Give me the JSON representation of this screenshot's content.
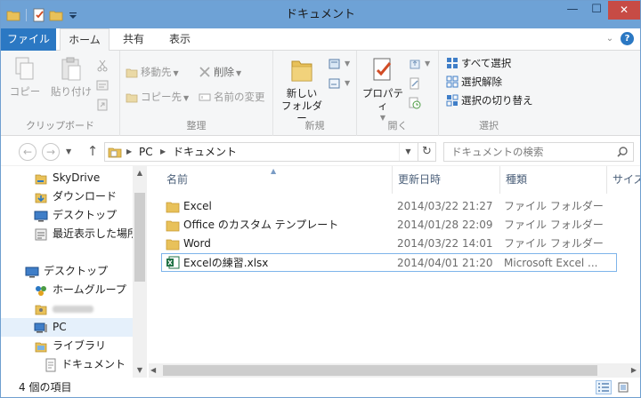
{
  "window": {
    "title": "ドキュメント",
    "controls": {
      "minimize": "—",
      "maximize": "☐",
      "close": "✕"
    }
  },
  "ribbon_tabs": {
    "file": "ファイル",
    "home": "ホーム",
    "share": "共有",
    "view": "表示",
    "help": "?"
  },
  "ribbon": {
    "clipboard": {
      "label": "クリップボード",
      "copy": "コピー",
      "paste": "貼り付け"
    },
    "organize": {
      "label": "整理",
      "move_to": "移動先",
      "copy_to": "コピー先",
      "delete": "削除",
      "rename": "名前の変更"
    },
    "new": {
      "label": "新規",
      "new_folder_line1": "新しい",
      "new_folder_line2": "フォルダー"
    },
    "open": {
      "label": "開く",
      "properties": "プロパティ"
    },
    "select": {
      "label": "選択",
      "select_all": "すべて選択",
      "select_none": "選択解除",
      "invert_selection": "選択の切り替え"
    }
  },
  "address_bar": {
    "segments": [
      "PC",
      "ドキュメント"
    ],
    "search_placeholder": "ドキュメントの検索"
  },
  "nav_pane": {
    "items": [
      {
        "label": "SkyDrive",
        "icon": "skydrive-icon"
      },
      {
        "label": "ダウンロード",
        "icon": "download-folder-icon"
      },
      {
        "label": "デスクトップ",
        "icon": "desktop-icon"
      },
      {
        "label": "最近表示した場所",
        "icon": "recent-places-icon"
      },
      {
        "label": "デスクトップ",
        "icon": "desktop-icon"
      },
      {
        "label": "ホームグループ",
        "icon": "homegroup-icon"
      },
      {
        "label": "",
        "icon": "user-folder-icon"
      },
      {
        "label": "PC",
        "icon": "pc-icon"
      },
      {
        "label": "ライブラリ",
        "icon": "library-icon"
      },
      {
        "label": "ドキュメント",
        "icon": "document-icon"
      }
    ]
  },
  "file_list": {
    "columns": {
      "name": "名前",
      "modified": "更新日時",
      "type": "種類",
      "size": "サイズ"
    },
    "rows": [
      {
        "name": "Excel",
        "modified": "2014/03/22 21:27",
        "type": "ファイル フォルダー",
        "icon": "folder-icon"
      },
      {
        "name": "Office のカスタム テンプレート",
        "modified": "2014/01/28 22:09",
        "type": "ファイル フォルダー",
        "icon": "folder-icon"
      },
      {
        "name": "Word",
        "modified": "2014/03/22 14:01",
        "type": "ファイル フォルダー",
        "icon": "folder-icon"
      },
      {
        "name": "Excelの練習.xlsx",
        "modified": "2014/04/01 21:20",
        "type": "Microsoft Excel ...",
        "icon": "excel-file-icon"
      }
    ]
  },
  "status_bar": {
    "item_count": "4 個の項目"
  },
  "colors": {
    "title_bar": "#6ea2d6",
    "file_tab": "#2b78c3",
    "close_button": "#c74b45",
    "folder": "#e8c15a",
    "excel": "#1f7244"
  }
}
